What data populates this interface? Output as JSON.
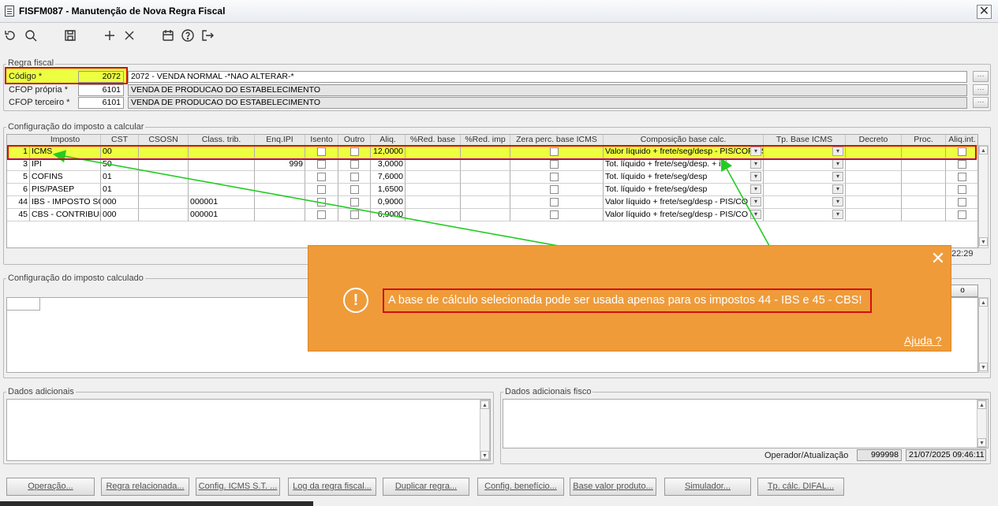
{
  "window": {
    "title": "FISFM087 - Manutenção de Nova Regra Fiscal",
    "close": "✕"
  },
  "toolbar": [
    "undo-icon",
    "search-icon",
    "save-icon",
    "add-icon",
    "close-icon",
    "calendar-icon",
    "help-icon",
    "exit-icon"
  ],
  "regra": {
    "group_label": "Regra fiscal",
    "codigo": {
      "label": "Código *",
      "value": "2072",
      "desc": "2072 - VENDA NORMAL -*NAO ALTERAR-*"
    },
    "cfop_propria": {
      "label": "CFOP própria *",
      "value": "6101",
      "desc": "VENDA DE PRODUCAO DO ESTABELECIMENTO"
    },
    "cfop_terceiro": {
      "label": "CFOP terceiro *",
      "value": "6101",
      "desc": "VENDA DE PRODUCAO DO ESTABELECIMENTO"
    },
    "dotbtn": "···"
  },
  "calc": {
    "group_label": "Configuração do imposto a calcular",
    "headers": [
      "Imposto",
      "CST",
      "CSOSN",
      "Class. trib.",
      "Enq.IPI",
      "Isento",
      "Outro",
      "Aliq.",
      "%Red. base",
      "%Red. imp",
      "Zera perc. base ICMS",
      "Composição base calc.",
      "Tp. Base ICMS",
      "Decreto",
      "Proc.",
      "Aliq.int."
    ],
    "rows": [
      {
        "num": "1",
        "imposto": "ICMS",
        "cst": "00",
        "csosn": "",
        "class": "",
        "enq": "",
        "aliq": "12,0000",
        "comp": "Valor líquido + frete/seg/desp - PIS/COFINS",
        "hl": true
      },
      {
        "num": "3",
        "imposto": "IPI",
        "cst": "50",
        "csosn": "",
        "class": "",
        "enq": "999",
        "aliq": "3,0000",
        "comp": "Tot. líquido + frete/seg/desp. + ipi"
      },
      {
        "num": "5",
        "imposto": "COFINS",
        "cst": "01",
        "csosn": "",
        "class": "",
        "enq": "",
        "aliq": "7,6000",
        "comp": "Tot. líquido + frete/seg/desp"
      },
      {
        "num": "6",
        "imposto": "PIS/PASEP",
        "cst": "01",
        "csosn": "",
        "class": "",
        "enq": "",
        "aliq": "1,6500",
        "comp": "Tot. líquido + frete/seg/desp"
      },
      {
        "num": "44",
        "imposto": "IBS - IMPOSTO SO",
        "cst": "000",
        "csosn": "",
        "class": "000001",
        "enq": "",
        "aliq": "0,9000",
        "comp": "Valor líquido + frete/seg/desp - PIS/CO"
      },
      {
        "num": "45",
        "imposto": "CBS - CONTRIBUIÇ",
        "cst": "000",
        "csosn": "",
        "class": "000001",
        "enq": "",
        "aliq": "6,9000",
        "comp": "Valor líquido + frete/seg/desp - PIS/CO"
      }
    ],
    "time": "22:29"
  },
  "calculado": {
    "group_label": "Configuração do imposto calculado",
    "btn": "o"
  },
  "dados": {
    "label": "Dados adicionais",
    "fisco_label": "Dados adicionais fisco",
    "operador_label": "Operador/Atualização",
    "operador": "999998",
    "data": "21/07/2025 09:46:11"
  },
  "toast": {
    "message": "A base de cálculo selecionada pode ser usada apenas para os impostos 44 - IBS e 45 - CBS!",
    "help": "Ajuda ?",
    "close": "✕",
    "icon": "!"
  },
  "buttons": [
    "Operação...",
    "Regra relacionada...",
    "Config. ICMS S.T. ...",
    "Log da regra fiscal...",
    "Duplicar regra...",
    "Config. benefício...",
    "Base valor produto...",
    "Simulador...",
    "Tp. cálc. DIFAL..."
  ]
}
